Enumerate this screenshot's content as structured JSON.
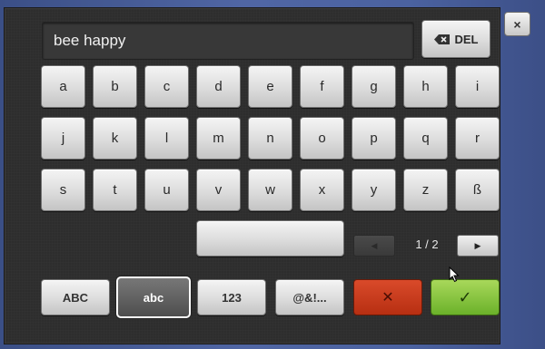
{
  "input": {
    "value": "bee happy"
  },
  "del_button": {
    "label": "DEL",
    "icon": "backspace-icon"
  },
  "close_button": {
    "label": "×",
    "icon": "close-icon"
  },
  "keys": {
    "row1": [
      "a",
      "b",
      "c",
      "d",
      "e",
      "f",
      "g",
      "h",
      "i"
    ],
    "row2": [
      "j",
      "k",
      "l",
      "m",
      "n",
      "o",
      "p",
      "q",
      "r"
    ],
    "row3": [
      "s",
      "t",
      "u",
      "v",
      "w",
      "x",
      "y",
      "z",
      "ß"
    ]
  },
  "pagination": {
    "prev": "◀",
    "next": "▶",
    "indicator": "1 / 2"
  },
  "modes": [
    "ABC",
    "abc",
    "123",
    "@&!..."
  ],
  "active_mode": "abc",
  "actions": {
    "cancel": "✕",
    "confirm": "✓"
  },
  "colors": {
    "cancel": "#c33a1b",
    "confirm": "#8cc63f",
    "panel": "#2d2d2d"
  }
}
